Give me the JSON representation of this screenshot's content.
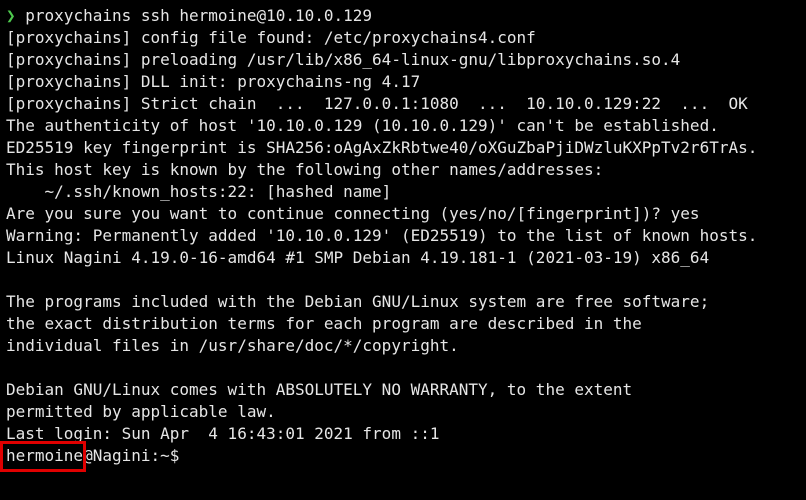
{
  "terminal": {
    "command_arrow": "❯",
    "command": " proxychains ssh hermoine@10.10.0.129",
    "lines": [
      "[proxychains] config file found: /etc/proxychains4.conf",
      "[proxychains] preloading /usr/lib/x86_64-linux-gnu/libproxychains.so.4",
      "[proxychains] DLL init: proxychains-ng 4.17",
      "[proxychains] Strict chain  ...  127.0.0.1:1080  ...  10.10.0.129:22  ...  OK",
      "The authenticity of host '10.10.0.129 (10.10.0.129)' can't be established.",
      "ED25519 key fingerprint is SHA256:oAgAxZkRbtwe40/oXGuZbaPjiDWzluKXPpTv2r6TrAs.",
      "This host key is known by the following other names/addresses:",
      "    ~/.ssh/known_hosts:22: [hashed name]",
      "Are you sure you want to continue connecting (yes/no/[fingerprint])? yes",
      "Warning: Permanently added '10.10.0.129' (ED25519) to the list of known hosts.",
      "Linux Nagini 4.19.0-16-amd64 #1 SMP Debian 4.19.181-1 (2021-03-19) x86_64",
      "",
      "The programs included with the Debian GNU/Linux system are free software;",
      "the exact distribution terms for each program are described in the",
      "individual files in /usr/share/doc/*/copyright.",
      "",
      "Debian GNU/Linux comes with ABSOLUTELY NO WARRANTY, to the extent",
      "permitted by applicable law.",
      "Last login: Sun Apr  4 16:43:01 2021 from ::1"
    ],
    "shell_prompt": {
      "user": "hermoine",
      "rest": "@Nagini:~$"
    },
    "colors": {
      "background": "#000000",
      "text": "#e6e6e6",
      "prompt_arrow": "#4ec94e",
      "highlight_box": "#e00000"
    }
  }
}
